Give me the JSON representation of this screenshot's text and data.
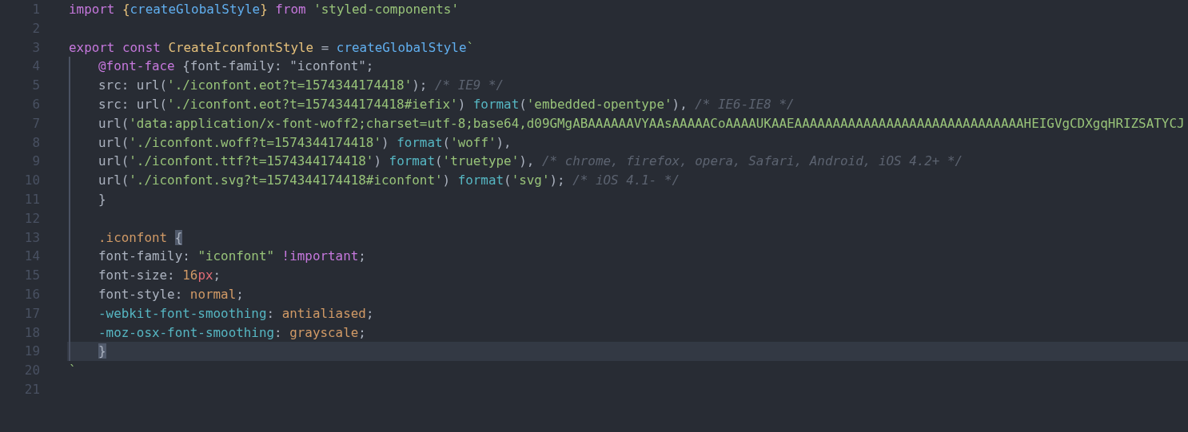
{
  "editor": {
    "lines": [
      {
        "number": "1",
        "current": false,
        "indented": false,
        "tokens": [
          {
            "t": "import",
            "kind": "kw"
          },
          {
            "t": " {",
            "kind": "brace"
          },
          {
            "t": "createGlobalStyle",
            "kind": "func"
          },
          {
            "t": "}",
            "kind": "brace"
          },
          {
            "t": " from",
            "kind": "kw"
          },
          {
            "t": " 'styled-components'",
            "kind": "str"
          }
        ]
      },
      {
        "number": "2",
        "current": false,
        "indented": false
      },
      {
        "number": "3",
        "current": false,
        "indented": false,
        "tokens": [
          {
            "t": "export",
            "kind": "kw"
          },
          {
            "t": " const",
            "kind": "kw"
          },
          {
            "t": " CreateIconfontStyle",
            "kind": "cls"
          },
          {
            "t": " = ",
            "kind": "plain"
          },
          {
            "t": "createGlobalStyle",
            "kind": "func"
          },
          {
            "t": "`",
            "kind": "str"
          }
        ]
      },
      {
        "number": "4",
        "current": false,
        "indented": true,
        "tokens": [
          {
            "t": "@font-face",
            "kind": "kw"
          },
          {
            "t": " {font-family: \"iconfont\";",
            "kind": "plain"
          }
        ]
      },
      {
        "number": "5",
        "current": false,
        "indented": true,
        "tokens": [
          {
            "t": "src: url(",
            "kind": "plain"
          },
          {
            "t": "'./iconfont.eot?t=1574344174418'",
            "kind": "str"
          },
          {
            "t": "); ",
            "kind": "plain"
          },
          {
            "t": "/* IE9 */",
            "kind": "cmt"
          }
        ]
      },
      {
        "number": "6",
        "current": false,
        "indented": true,
        "tokens": [
          {
            "t": "src: url(",
            "kind": "plain"
          },
          {
            "t": "'./iconfont.eot?t=1574344174418#iefix'",
            "kind": "str"
          },
          {
            "t": ") ",
            "kind": "plain"
          },
          {
            "t": "format",
            "kind": "fmt"
          },
          {
            "t": "(",
            "kind": "plain"
          },
          {
            "t": "'embedded-opentype'",
            "kind": "str"
          },
          {
            "t": "), ",
            "kind": "plain"
          },
          {
            "t": "/* IE6-IE8 */",
            "kind": "cmt"
          }
        ]
      },
      {
        "number": "7",
        "current": false,
        "indented": true,
        "tokens": [
          {
            "t": "url(",
            "kind": "plain"
          },
          {
            "t": "'data:application/x-font-woff2;charset=utf-8;base64,d09GMgABAAAAAAVYAAsAAAAACoAAAAUKAAEAAAAAAAAAAAAAAAAAAAAAAAAAAAAAAHEIGVgCDXgqHRIZSATYCJ",
            "kind": "str"
          }
        ]
      },
      {
        "number": "8",
        "current": false,
        "indented": true,
        "tokens": [
          {
            "t": "url(",
            "kind": "plain"
          },
          {
            "t": "'./iconfont.woff?t=1574344174418'",
            "kind": "str"
          },
          {
            "t": ") ",
            "kind": "plain"
          },
          {
            "t": "format",
            "kind": "fmt"
          },
          {
            "t": "(",
            "kind": "plain"
          },
          {
            "t": "'woff'",
            "kind": "str"
          },
          {
            "t": "),",
            "kind": "plain"
          }
        ]
      },
      {
        "number": "9",
        "current": false,
        "indented": true,
        "tokens": [
          {
            "t": "url(",
            "kind": "plain"
          },
          {
            "t": "'./iconfont.ttf?t=1574344174418'",
            "kind": "str"
          },
          {
            "t": ") ",
            "kind": "plain"
          },
          {
            "t": "format",
            "kind": "fmt"
          },
          {
            "t": "(",
            "kind": "plain"
          },
          {
            "t": "'truetype'",
            "kind": "str"
          },
          {
            "t": "), ",
            "kind": "plain"
          },
          {
            "t": "/* chrome, firefox, opera, Safari, Android, iOS 4.2+ */",
            "kind": "cmt"
          }
        ]
      },
      {
        "number": "10",
        "current": false,
        "indented": true,
        "tokens": [
          {
            "t": "url(",
            "kind": "plain"
          },
          {
            "t": "'./iconfont.svg?t=1574344174418#iconfont'",
            "kind": "str"
          },
          {
            "t": ") ",
            "kind": "plain"
          },
          {
            "t": "format",
            "kind": "fmt"
          },
          {
            "t": "(",
            "kind": "plain"
          },
          {
            "t": "'svg'",
            "kind": "str"
          },
          {
            "t": "); ",
            "kind": "plain"
          },
          {
            "t": "/* iOS 4.1- */",
            "kind": "cmt"
          }
        ]
      },
      {
        "number": "11",
        "current": false,
        "indented": true,
        "tokens": [
          {
            "t": "}",
            "kind": "plain"
          }
        ]
      },
      {
        "number": "12",
        "current": false,
        "indented": true
      },
      {
        "number": "13",
        "current": false,
        "indented": true,
        "tokens": [
          {
            "t": ".iconfont ",
            "kind": "sel"
          },
          {
            "t": "{",
            "kind": "match"
          }
        ]
      },
      {
        "number": "14",
        "current": false,
        "indented": true,
        "tokens": [
          {
            "t": "font-family: ",
            "kind": "plain"
          },
          {
            "t": "\"iconfont\"",
            "kind": "str"
          },
          {
            "t": " !important",
            "kind": "kw"
          },
          {
            "t": ";",
            "kind": "plain"
          }
        ]
      },
      {
        "number": "15",
        "current": false,
        "indented": true,
        "tokens": [
          {
            "t": "font-size: ",
            "kind": "plain"
          },
          {
            "t": "16",
            "kind": "num"
          },
          {
            "t": "px",
            "kind": "unit"
          },
          {
            "t": ";",
            "kind": "plain"
          }
        ]
      },
      {
        "number": "16",
        "current": false,
        "indented": true,
        "tokens": [
          {
            "t": "font-style: ",
            "kind": "plain"
          },
          {
            "t": "normal",
            "kind": "val"
          },
          {
            "t": ";",
            "kind": "plain"
          }
        ]
      },
      {
        "number": "17",
        "current": false,
        "indented": true,
        "tokens": [
          {
            "t": "-webkit-font-smoothing",
            "kind": "prop"
          },
          {
            "t": ": ",
            "kind": "plain"
          },
          {
            "t": "antialiased",
            "kind": "val"
          },
          {
            "t": ";",
            "kind": "plain"
          }
        ]
      },
      {
        "number": "18",
        "current": false,
        "indented": true,
        "tokens": [
          {
            "t": "-moz-osx-font-smoothing",
            "kind": "prop"
          },
          {
            "t": ": ",
            "kind": "plain"
          },
          {
            "t": "grayscale",
            "kind": "val"
          },
          {
            "t": ";",
            "kind": "plain"
          }
        ]
      },
      {
        "number": "19",
        "current": true,
        "indented": true,
        "tokens": [
          {
            "t": "}",
            "kind": "match"
          }
        ]
      },
      {
        "number": "20",
        "current": false,
        "indented": false,
        "tokens": [
          {
            "t": "`",
            "kind": "str"
          }
        ]
      },
      {
        "number": "21",
        "current": false,
        "indented": false
      }
    ]
  }
}
